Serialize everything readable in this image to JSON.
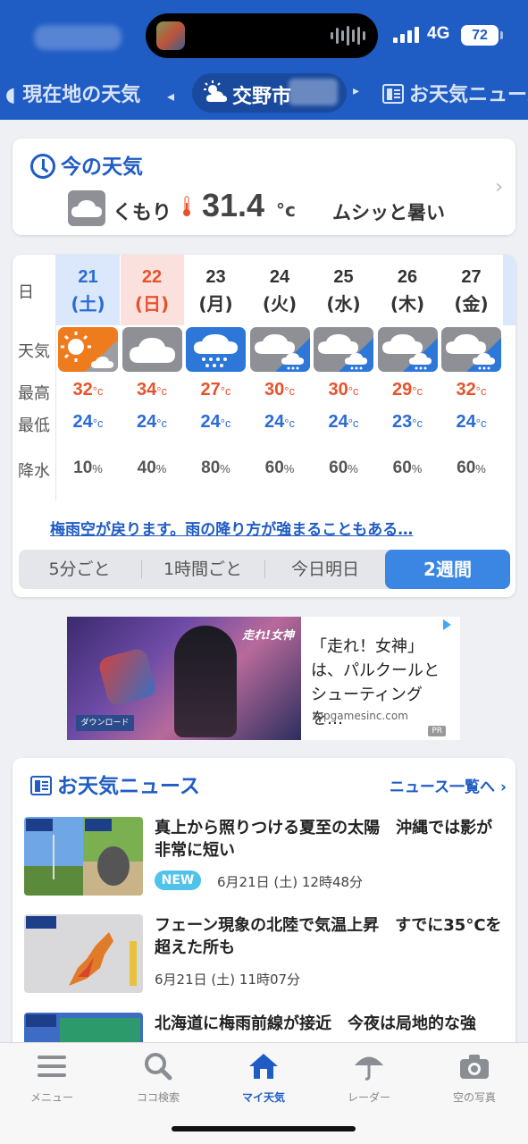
{
  "status": {
    "network": "4G",
    "battery": "72"
  },
  "nav": {
    "left": "現在地の天気",
    "city": "交野市",
    "right": "お天気ニュース"
  },
  "now": {
    "title": "今の天気",
    "condition": "くもり",
    "temp": "31.4",
    "unit": "°c",
    "feel": "ムシッと暑い"
  },
  "weekly": {
    "row_labels": {
      "day": "日",
      "weather": "天気",
      "high": "最高",
      "low": "最低",
      "precip": "降水"
    },
    "days": [
      {
        "num": "21",
        "wd": "(土)",
        "kind": "sat",
        "icon": "sunny-then-cloudy-icon",
        "high": "32",
        "low": "24",
        "precip": "10"
      },
      {
        "num": "22",
        "wd": "(日)",
        "kind": "sun",
        "icon": "cloudy-icon",
        "high": "34",
        "low": "24",
        "precip": "40"
      },
      {
        "num": "23",
        "wd": "(月)",
        "kind": "wk",
        "icon": "rain-icon",
        "high": "27",
        "low": "24",
        "precip": "80"
      },
      {
        "num": "24",
        "wd": "(火)",
        "kind": "wk",
        "icon": "cloudy-then-rain-icon",
        "high": "30",
        "low": "24",
        "precip": "60"
      },
      {
        "num": "25",
        "wd": "(水)",
        "kind": "wk",
        "icon": "cloudy-then-rain-icon",
        "high": "30",
        "low": "24",
        "precip": "60"
      },
      {
        "num": "26",
        "wd": "(木)",
        "kind": "wk",
        "icon": "cloudy-then-rain-icon",
        "high": "29",
        "low": "23",
        "precip": "60"
      },
      {
        "num": "27",
        "wd": "(金)",
        "kind": "wk",
        "icon": "cloudy-then-rain-icon",
        "high": "32",
        "low": "24",
        "precip": "60"
      }
    ],
    "temp_unit": "°c",
    "precip_unit": "%",
    "headline": "梅雨空が戻ります。雨の降り方が強まることもある…",
    "tabs": [
      "5分ごと",
      "1時間ごと",
      "今日明日",
      "2週間"
    ]
  },
  "ad": {
    "text": "「走れ！女神」は、パルクールとシューティングを…",
    "url": "topgamesinc.com",
    "pr": "PR",
    "image_logo": "走れ!女神",
    "image_download": "ダウンロード"
  },
  "news": {
    "title": "お天気ニュース",
    "more": "ニュース一覧へ",
    "items": [
      {
        "title": "真上から照りつける夏至の太陽　沖縄では影が非常に短い",
        "badge": "NEW",
        "date": "6月21日 (土) 12時48分"
      },
      {
        "title": "フェーン現象の北陸で気温上昇　すでに35°Cを超えた所も",
        "date": "6月21日 (土) 11時07分"
      },
      {
        "title": "北海道に梅雨前線が接近　今夜は局地的な強"
      }
    ]
  },
  "tabbar": [
    {
      "label": "メニュー",
      "icon": "menu-icon"
    },
    {
      "label": "ココ検索",
      "icon": "search-icon"
    },
    {
      "label": "マイ天気",
      "icon": "home-icon"
    },
    {
      "label": "レーダー",
      "icon": "umbrella-icon"
    },
    {
      "label": "空の写真",
      "icon": "camera-icon"
    }
  ],
  "colors": {
    "brand": "#1f5cc4",
    "high": "#e8522b",
    "low": "#2a6bd6",
    "active_tab": "#3a86e2"
  }
}
